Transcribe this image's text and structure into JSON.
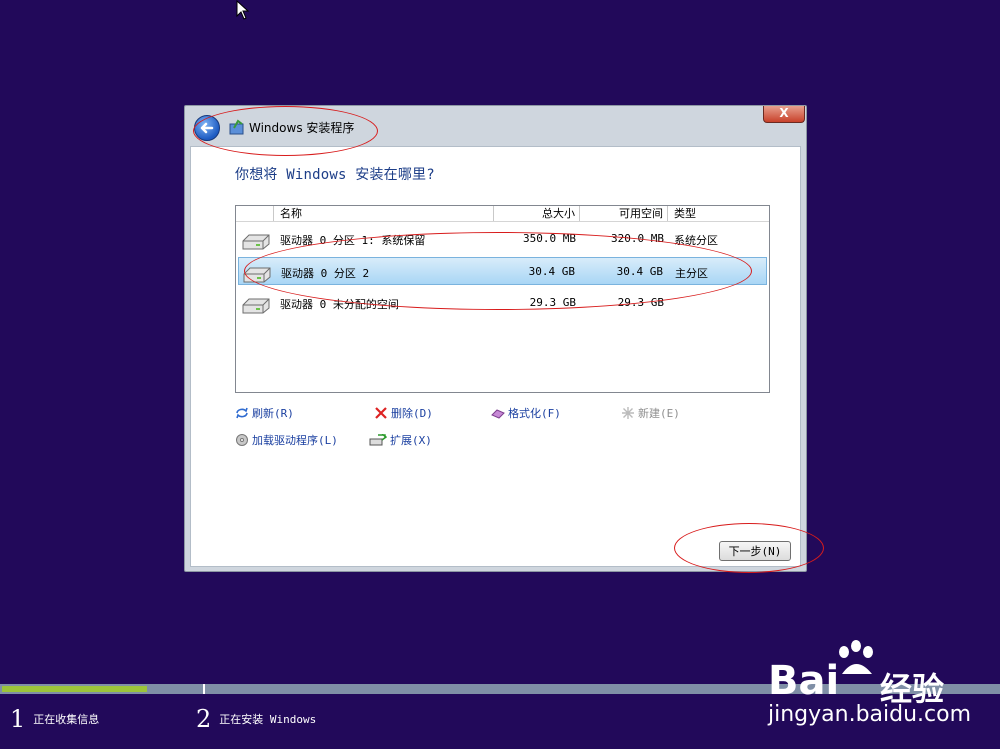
{
  "dialog": {
    "title": "Windows 安装程序",
    "close_label": "X",
    "question": "你想将 Windows 安装在哪里?",
    "table": {
      "headers": [
        "名称",
        "总大小",
        "可用空间",
        "类型"
      ],
      "rows": [
        {
          "name": "驱动器 0 分区 1: 系统保留",
          "total": "350.0 MB",
          "free": "320.0 MB",
          "type": "系统分区"
        },
        {
          "name": "驱动器 0 分区 2",
          "total": "30.4 GB",
          "free": "30.4 GB",
          "type": "主分区"
        },
        {
          "name": "驱动器 0 未分配的空间",
          "total": "29.3 GB",
          "free": "29.3 GB",
          "type": ""
        }
      ]
    },
    "actions": {
      "refresh": "刷新(R)",
      "delete": "删除(D)",
      "format": "格式化(F)",
      "new": "新建(E)",
      "load_driver": "加载驱动程序(L)",
      "extend": "扩展(X)"
    },
    "next_label": "下一步(N)"
  },
  "progress": {
    "fraction_complete": 0.145,
    "steps": [
      {
        "number": "1",
        "label": "正在收集信息"
      },
      {
        "number": "2",
        "label": "正在安装 Windows"
      }
    ]
  },
  "watermark": {
    "brand": "Bai",
    "brand2": "经验",
    "url": "jingyan.baidu.com"
  },
  "colors": {
    "background": "#22095a",
    "progress_fill": "#9cc43a",
    "question_text": "#1d3e88",
    "annotation": "#d81c1c"
  }
}
